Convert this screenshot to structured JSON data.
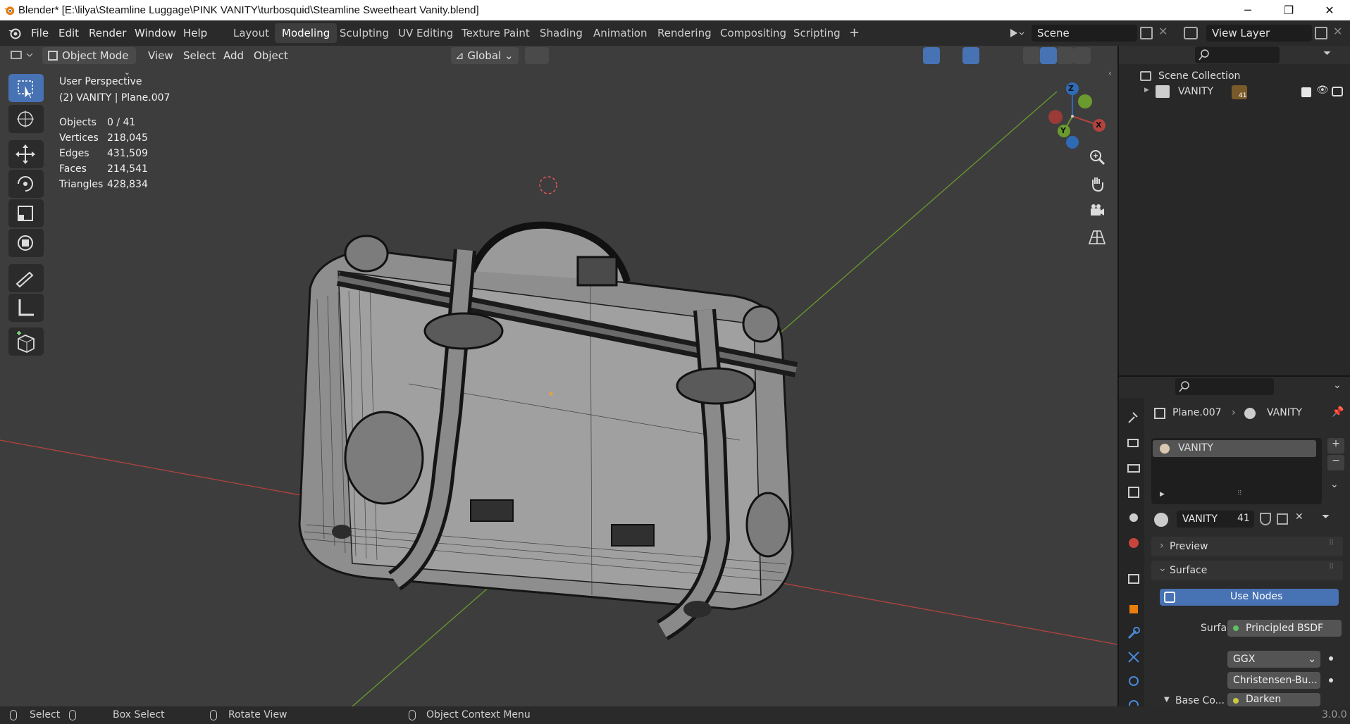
{
  "titlebar": {
    "title": "Blender* [E:\\lilya\\Steamline Luggage\\PINK VANITY\\turbosquid\\Steamline Sweetheart Vanity.blend]",
    "minimize": "─",
    "maximize": "❐",
    "close": "✕"
  },
  "menus": [
    "File",
    "Edit",
    "Render",
    "Window",
    "Help"
  ],
  "workspaces": [
    "Layout",
    "Modeling",
    "Sculpting",
    "UV Editing",
    "Texture Paint",
    "Shading",
    "Animation",
    "Rendering",
    "Compositing",
    "Scripting"
  ],
  "active_workspace": "Modeling",
  "add_workspace": "+",
  "scene": {
    "name": "Scene",
    "view_layer": "View Layer"
  },
  "viewport_header": {
    "mode": "Object Mode",
    "menus": [
      "View",
      "Select",
      "Add",
      "Object"
    ],
    "transform_orientation": "Global"
  },
  "overlay_text": {
    "perspective": "User Perspective",
    "object_info": "(2)  VANITY | Plane.007"
  },
  "stats": [
    {
      "label": "Objects",
      "value": "0 / 41"
    },
    {
      "label": "Vertices",
      "value": "218,045"
    },
    {
      "label": "Edges",
      "value": "431,509"
    },
    {
      "label": "Faces",
      "value": "214,541"
    },
    {
      "label": "Triangles",
      "value": "428,834"
    }
  ],
  "gizmo": {
    "z": "Z",
    "y": "Y",
    "x": "X"
  },
  "outliner": {
    "root": "Scene Collection",
    "items": [
      {
        "name": "VANITY",
        "count": "41"
      }
    ]
  },
  "properties": {
    "breadcrumb_object": "Plane.007",
    "breadcrumb_material": "VANITY",
    "slot": "VANITY",
    "material_name": "VANITY",
    "users": "41",
    "sections": {
      "preview": "Preview",
      "surface": "Surface"
    },
    "use_nodes": "Use Nodes",
    "surface_label": "Surface",
    "surface_value": "Principled BSDF",
    "distribution": "GGX",
    "subsurface": "Christensen-Bu...",
    "base_color_label": "Base Co...",
    "base_color_value": "Darken"
  },
  "statusbar": {
    "select": "Select",
    "box_select": "Box Select",
    "rotate": "Rotate View",
    "context": "Object Context Menu",
    "version": "3.0.0"
  },
  "colors": {
    "accent": "#4772b3",
    "x_axis": "#b3433f",
    "y_axis": "#6b9a2e",
    "z_axis": "#2f6bb5"
  }
}
